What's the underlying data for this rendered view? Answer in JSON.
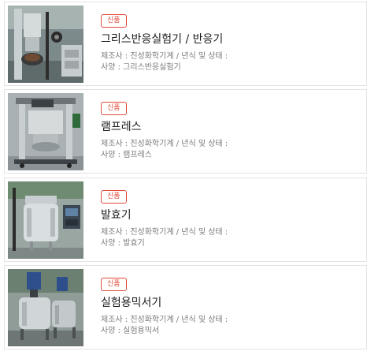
{
  "products": [
    {
      "badge": "신품",
      "title": "그리스반응실험기 / 반응기",
      "meta_line1": "제조사 : 진성화학기계 / 년식 및 상태 :",
      "meta_line2": "사양 : 그리스반응실험기",
      "image_icon": "reactor-machine-photo"
    },
    {
      "badge": "신품",
      "title": "램프레스",
      "meta_line1": "제조사 : 진성화학기계 / 년식 및 상태 :",
      "meta_line2": "사양 : 램프레스",
      "image_icon": "ram-press-photo"
    },
    {
      "badge": "신품",
      "title": "발효기",
      "meta_line1": "제조사 : 진성화학기계 / 년식 및 상태 :",
      "meta_line2": "사양 : 발효기",
      "image_icon": "fermenter-photo"
    },
    {
      "badge": "신품",
      "title": "실험용믹서기",
      "meta_line1": "제조사 : 진성화학기계 / 년식 및 상태 :",
      "meta_line2": "사양 : 실험용믹서",
      "image_icon": "lab-mixer-photo"
    }
  ],
  "colors": {
    "badge_accent": "#e04a3a",
    "card_border": "#e3e3e3",
    "meta_text": "#7a7a7a"
  }
}
